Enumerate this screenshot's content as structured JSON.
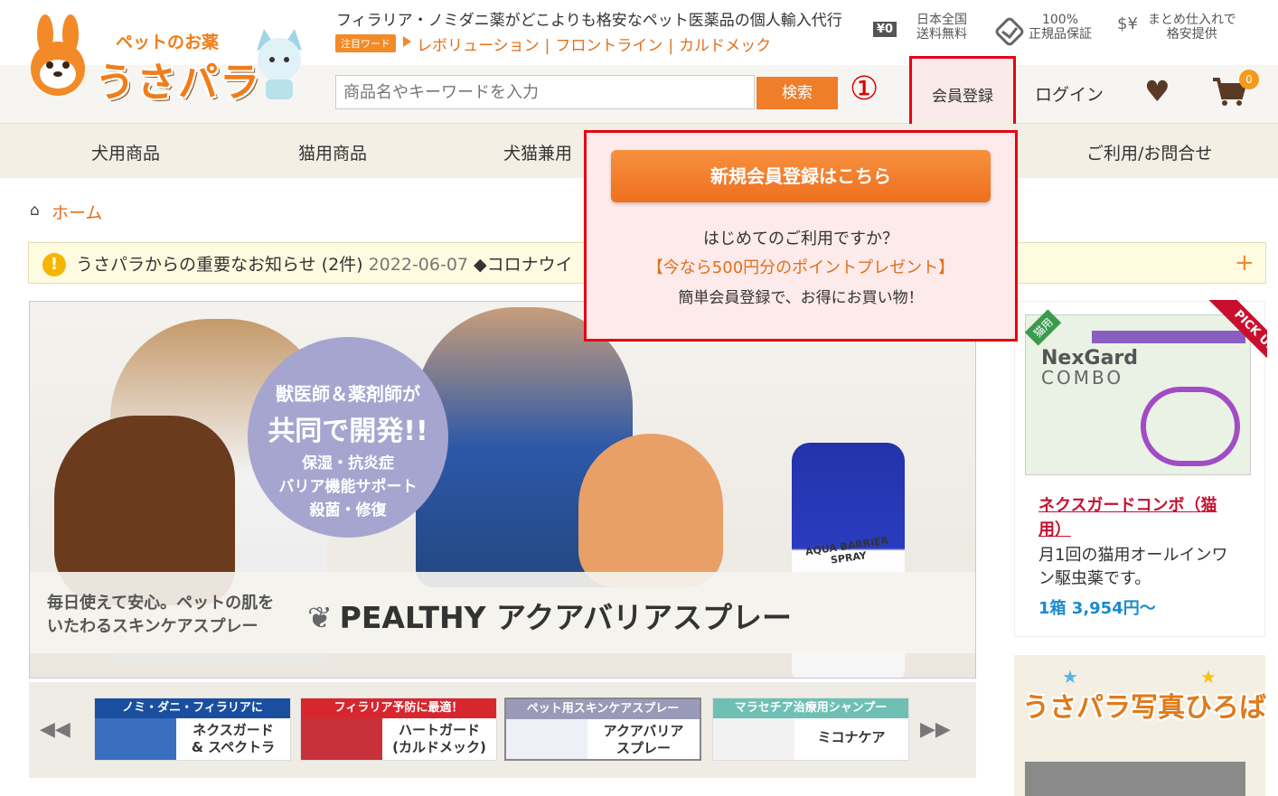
{
  "header": {
    "logo_small": "ペットのお薬",
    "logo_big": "うさパラ",
    "tagline": "フィラリア・ノミダニ薬がどこよりも格安なペット医薬品の個人輸入代行",
    "keyword_badge": "注目ワード",
    "keywords": [
      "レボリューション",
      "フロントライン",
      "カルドメック"
    ],
    "features": [
      {
        "icon": "yen-truck-icon",
        "glyph": "¥0",
        "line1": "日本全国",
        "line2": "送料無料"
      },
      {
        "icon": "handshake-icon",
        "glyph": "",
        "line1": "100%",
        "line2": "正規品保証"
      },
      {
        "icon": "dollar-yen-icon",
        "glyph": "$¥",
        "line1": "まとめ仕入れで",
        "line2": "格安提供"
      }
    ],
    "search_placeholder": "商品名やキーワードを入力",
    "search_button": "検索",
    "annotation_number": "①",
    "register_label": "会員登録",
    "login_label": "ログイン",
    "cart_count": "0"
  },
  "nav": [
    "犬用商品",
    "猫用商品",
    "犬猫兼用",
    "ご利用/お問合せ"
  ],
  "breadcrumb": {
    "home": "ホーム"
  },
  "notice": {
    "text": "うさパラからの重要なお知らせ (2件)",
    "date": "2022-06-07",
    "headline": "◆コロナウイ"
  },
  "banner": {
    "bubble_line1": "獣医師＆薬剤師が",
    "bubble_line2": "共同で開発!!",
    "bubble_line3": "保湿・抗炎症",
    "bubble_line4": "バリア機能サポート",
    "bubble_line5": "殺菌・修復",
    "sub_line1": "毎日使えて安心。ペットの肌を",
    "sub_line2": "いたわるスキンケアスプレー",
    "product_name": "PEALTHY アクアバリアスプレー",
    "bottle_label": "AQUA BARRIER SPRAY"
  },
  "carousel": [
    {
      "head": "ノミ・ダニ・フィラリアに",
      "name1": "ネクスガード",
      "name2": "& スペクトラ",
      "color": "#1a4fa0"
    },
    {
      "head": "フィラリア予防に最適！",
      "name1": "ハートガード",
      "name2": "(カルドメック)",
      "color": "#d8262e"
    },
    {
      "head": "ペット用スキンケアスプレー",
      "name1": "アクアバリア",
      "name2": "スプレー",
      "color": "#9a9ab8"
    },
    {
      "head": "マラセチア治療用シャンプー",
      "name1": "ミコナケア",
      "name2": "",
      "color": "#6fc0b4"
    }
  ],
  "pickup": {
    "ribbon": "PICK UP",
    "tag": "猫用",
    "image_brand": "NexGard",
    "image_sub": "COMBO",
    "name": "ネクスガードコンボ（猫用）",
    "desc": "月1回の猫用オールインワン駆虫薬です。",
    "price": "1箱 3,954円〜"
  },
  "photo": {
    "title": "うさパラ写真ひろば"
  },
  "dropdown": {
    "button": "新規会員登録はこちら",
    "line1": "はじめてのご利用ですか？",
    "line2": "【今なら500円分のポイントプレゼント】",
    "line3": "簡単会員登録で、お得にお買い物！"
  }
}
